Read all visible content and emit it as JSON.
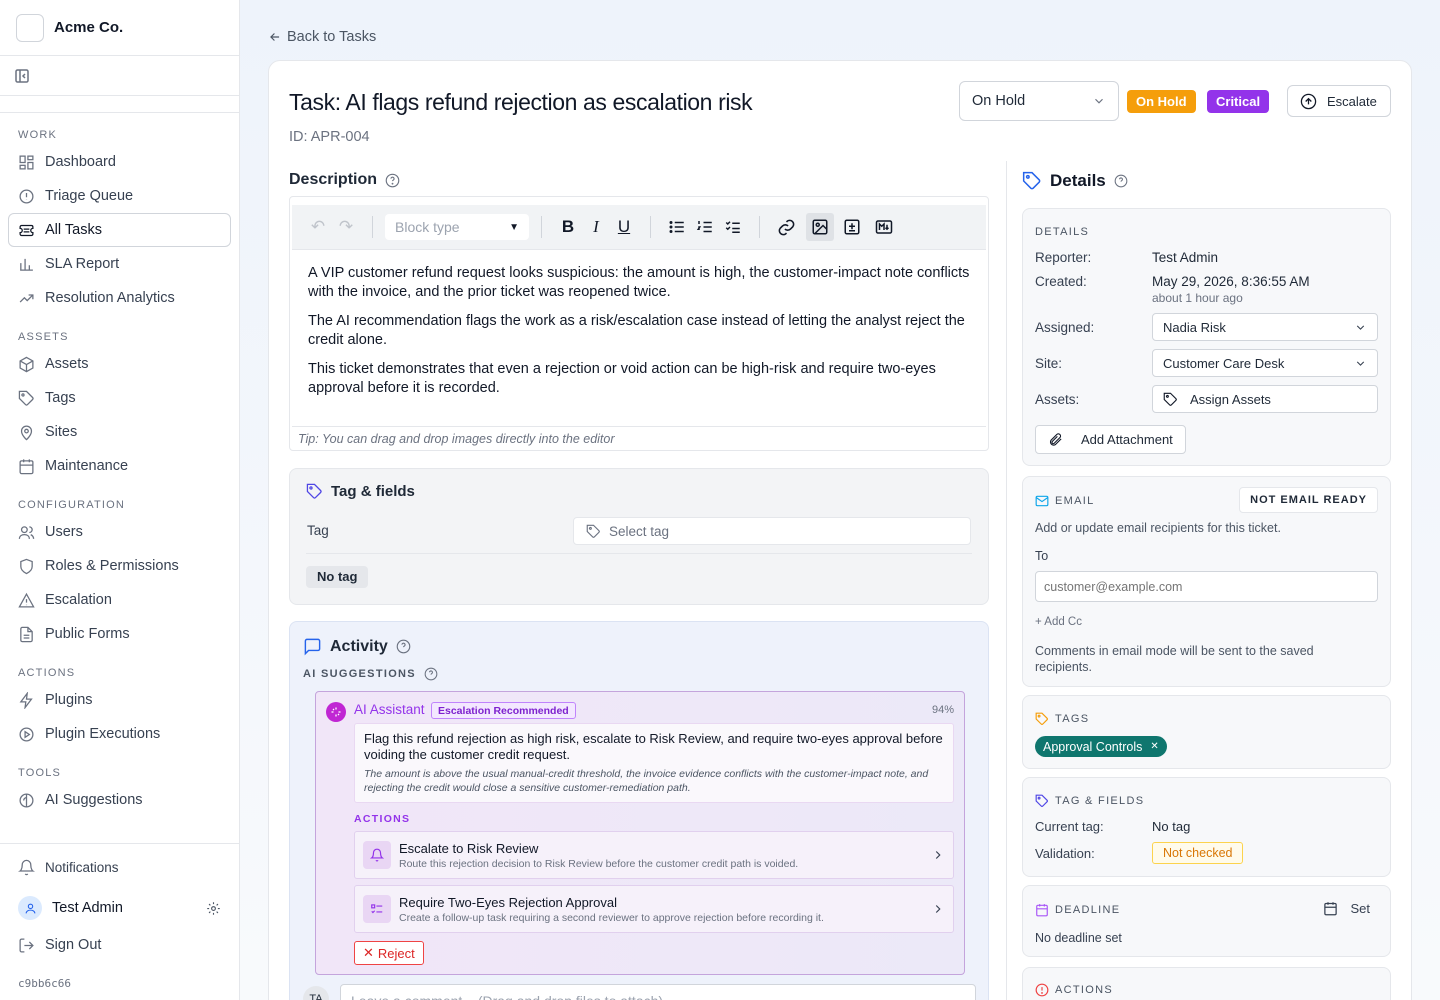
{
  "org": "Acme Co.",
  "sidebar": {
    "sections": [
      {
        "label": "WORK",
        "items": [
          {
            "label": "Dashboard",
            "icon": "dashboard-icon"
          },
          {
            "label": "Triage Queue",
            "icon": "alert-circle-icon"
          },
          {
            "label": "All Tasks",
            "icon": "ticket-icon",
            "active": true
          },
          {
            "label": "SLA Report",
            "icon": "bar-chart-icon"
          },
          {
            "label": "Resolution Analytics",
            "icon": "trending-icon"
          }
        ]
      },
      {
        "label": "ASSETS",
        "items": [
          {
            "label": "Assets",
            "icon": "cube-icon"
          },
          {
            "label": "Tags",
            "icon": "tag-icon"
          },
          {
            "label": "Sites",
            "icon": "map-pin-icon"
          },
          {
            "label": "Maintenance",
            "icon": "calendar-icon"
          }
        ]
      },
      {
        "label": "CONFIGURATION",
        "items": [
          {
            "label": "Users",
            "icon": "users-icon"
          },
          {
            "label": "Roles & Permissions",
            "icon": "shield-icon"
          },
          {
            "label": "Escalation",
            "icon": "triangle-alert-icon"
          },
          {
            "label": "Public Forms",
            "icon": "file-icon"
          }
        ]
      },
      {
        "label": "ACTIONS",
        "items": [
          {
            "label": "Plugins",
            "icon": "zap-icon"
          },
          {
            "label": "Plugin Executions",
            "icon": "play-circle-icon"
          }
        ]
      },
      {
        "label": "TOOLS",
        "items": [
          {
            "label": "AI Suggestions",
            "icon": "ai-icon"
          }
        ]
      }
    ],
    "notifications": "Notifications",
    "user_name": "Test Admin",
    "sign_out": "Sign Out",
    "version": "c9bb6c66"
  },
  "back_link": "Back to Tasks",
  "task": {
    "title": "Task: AI flags refund rejection as escalation risk",
    "id": "ID: APR-004",
    "status": "On Hold",
    "badge_status": "On Hold",
    "badge_priority": "Critical",
    "escalate": "Escalate"
  },
  "colors": {
    "on_hold": "#f59e0b",
    "critical": "#9333ea",
    "accent": "#2563eb",
    "teal": "#0f766e"
  },
  "description": {
    "heading": "Description",
    "block_type_placeholder": "Block type",
    "paragraphs": [
      "A VIP customer refund request looks suspicious: the amount is high, the customer-impact note conflicts with the invoice, and the prior ticket was reopened twice.",
      "The AI recommendation flags the work as a risk/escalation case instead of letting the analyst reject the credit alone.",
      "This ticket demonstrates that even a rejection or void action can be high-risk and require two-eyes approval before it is recorded."
    ],
    "tip": "Tip: You can drag and drop images directly into the editor"
  },
  "tag_fields": {
    "heading": "Tag & fields",
    "tag_label": "Tag",
    "select_placeholder": "Select tag",
    "no_tag": "No tag"
  },
  "activity": {
    "heading": "Activity",
    "ai_label": "AI SUGGESTIONS",
    "assistant": "AI Assistant",
    "recommend_badge": "Escalation Recommended",
    "confidence": "94%",
    "summary": "Flag this refund rejection as high risk, escalate to Risk Review, and require two-eyes approval before voiding the customer credit request.",
    "reasoning": "The amount is above the usual manual-credit threshold, the invoice evidence conflicts with the customer-impact note, and rejecting the credit would close a sensitive customer-remediation path.",
    "actions_label": "ACTIONS",
    "actions": [
      {
        "title": "Escalate to Risk Review",
        "desc": "Route this rejection decision to Risk Review before the customer credit path is voided."
      },
      {
        "title": "Require Two-Eyes Rejection Approval",
        "desc": "Create a follow-up task requiring a second reviewer to approve rejection before recording it."
      }
    ],
    "reject": "Reject",
    "commenter_initials": "TA",
    "comment_placeholder": "Leave a comment... (Drag and drop files to attach)"
  },
  "details": {
    "heading": "Details",
    "section_label": "DETAILS",
    "reporter_label": "Reporter:",
    "reporter": "Test Admin",
    "created_label": "Created:",
    "created": "May 29, 2026, 8:36:55 AM",
    "created_rel": "about 1 hour ago",
    "assigned_label": "Assigned:",
    "assigned": "Nadia Risk",
    "site_label": "Site:",
    "site": "Customer Care Desk",
    "assets_label": "Assets:",
    "assets_btn": "Assign Assets",
    "attachment_btn": "Add Attachment"
  },
  "email": {
    "label": "EMAIL",
    "status": "NOT EMAIL READY",
    "help": "Add or update email recipients for this ticket.",
    "to_label": "To",
    "to_placeholder": "customer@example.com",
    "add_cc": "+ Add Cc",
    "note": "Comments in email mode will be sent to the saved recipients."
  },
  "tags": {
    "label": "TAGS",
    "chip": "Approval Controls"
  },
  "tag_panel": {
    "label": "TAG & FIELDS",
    "current_label": "Current tag:",
    "current": "No tag",
    "validation_label": "Validation:",
    "validation": "Not checked"
  },
  "deadline": {
    "label": "DEADLINE",
    "set": "Set",
    "none": "No deadline set"
  },
  "actions_panel": {
    "label": "ACTIONS"
  }
}
